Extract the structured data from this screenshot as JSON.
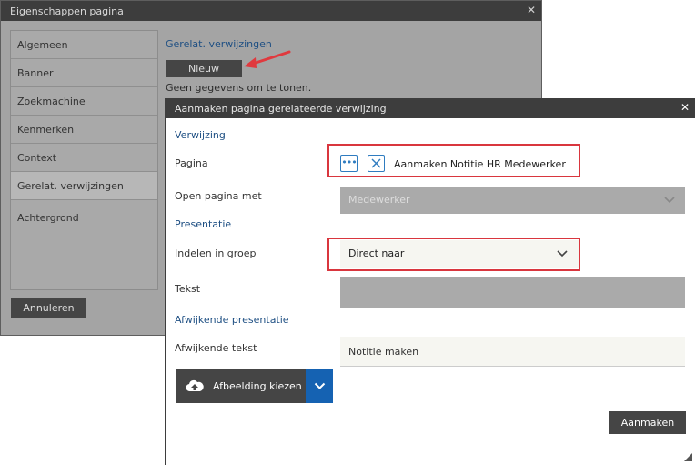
{
  "props_dialog": {
    "title": "Eigenschappen pagina",
    "close_glyph": "✕",
    "nav_items": [
      {
        "label": "Algemeen"
      },
      {
        "label": "Banner"
      },
      {
        "label": "Zoekmachine"
      },
      {
        "label": "Kenmerken"
      },
      {
        "label": "Context"
      },
      {
        "label": "Gerelat. verwijzingen"
      },
      {
        "label": "Achtergrond"
      }
    ],
    "active_item": "Gerelat. verwijzingen",
    "section_heading": "Gerelat. verwijzingen",
    "new_button": "Nieuw",
    "empty_text": "Geen gegevens om te tonen.",
    "cancel_button": "Annuleren"
  },
  "create_dialog": {
    "title": "Aanmaken pagina gerelateerde verwijzing",
    "close_glyph": "✕",
    "section_verwijzing": "Verwijzing",
    "pagina_label": "Pagina",
    "pagina_more_glyph": "•••",
    "pagina_value": "Aanmaken Notitie HR Medewerker",
    "open_label": "Open pagina met",
    "open_value": "Medewerker",
    "section_presentatie": "Presentatie",
    "groep_label": "Indelen in groep",
    "groep_value": "Direct naar",
    "tekst_label": "Tekst",
    "tekst_value": "",
    "section_afwijkend": "Afwijkende presentatie",
    "afw_tekst_label": "Afwijkende tekst",
    "afw_tekst_value": "Notitie maken",
    "image_button": "Afbeelding kiezen",
    "create_button": "Aanmaken"
  },
  "colors": {
    "highlight": "#d9363e",
    "accent": "#1562b2",
    "heading": "#1e4f83",
    "dark_button": "#454545"
  }
}
